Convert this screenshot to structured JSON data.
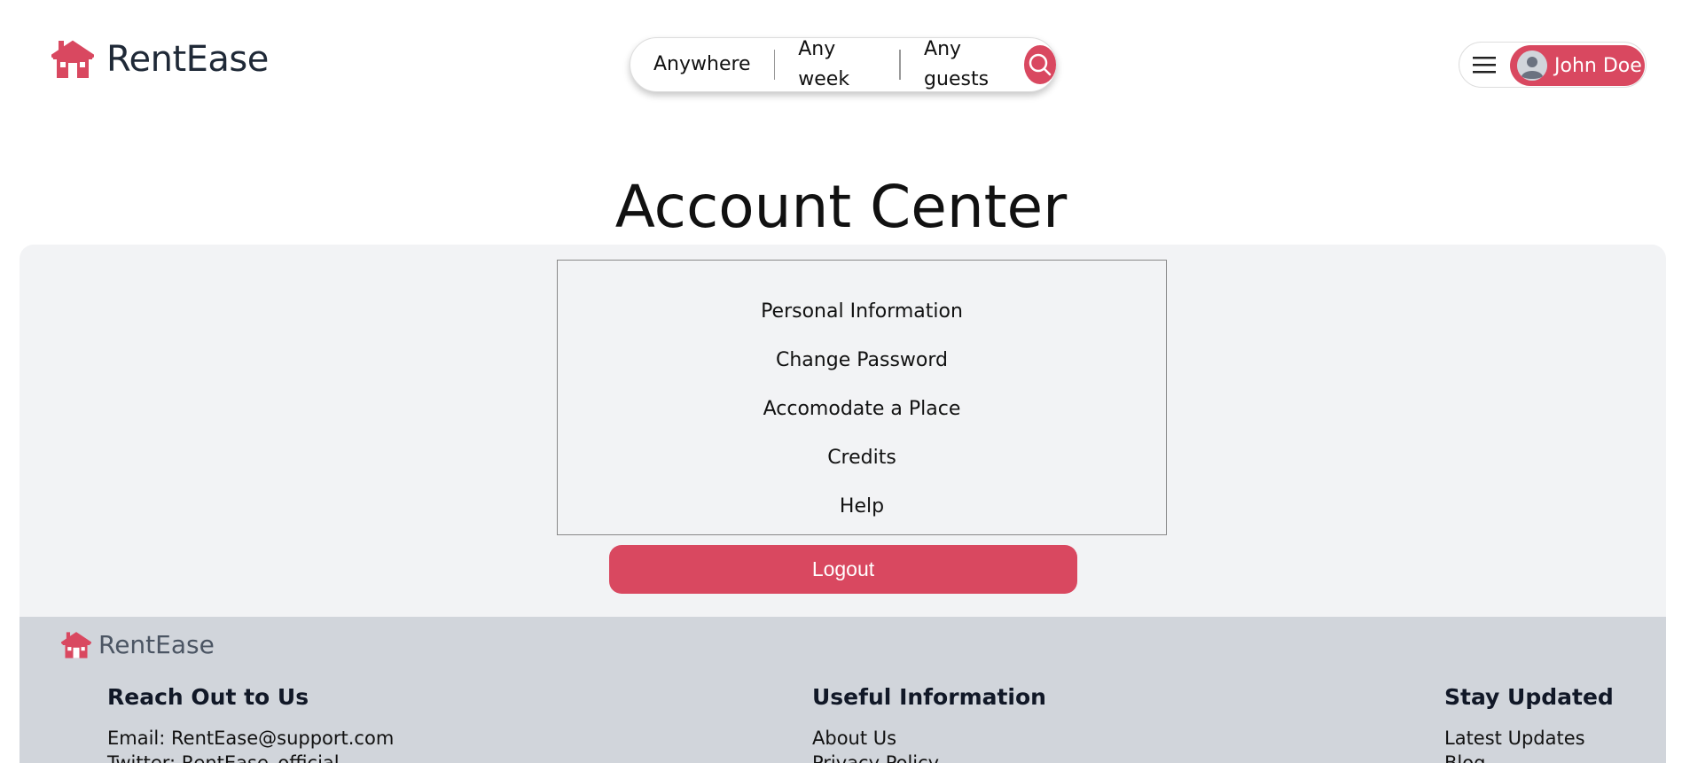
{
  "header": {
    "brand": "RentEase",
    "search": {
      "where": "Anywhere",
      "when": "Any week",
      "who": "Any guests"
    },
    "user": {
      "name": "John Doe"
    }
  },
  "main": {
    "title": "Account Center",
    "menu": [
      "Personal Information",
      "Change Password",
      "Accomodate a Place",
      "Credits",
      "Help"
    ],
    "logout_label": "Logout"
  },
  "footer": {
    "brand": "RentEase",
    "columns": [
      {
        "heading": "Reach Out to Us",
        "links": [
          "Email: RentEase@support.com",
          "Twitter: RentEase_official"
        ]
      },
      {
        "heading": "Useful Information",
        "links": [
          "About Us",
          "Privacy Policy"
        ]
      },
      {
        "heading": "Stay Updated",
        "links": [
          "Latest Updates",
          "Blog"
        ]
      }
    ]
  },
  "colors": {
    "accent": "#d94860",
    "panel": "#f2f3f5",
    "footer": "#d1d5db"
  },
  "icons": [
    "house-logo-icon",
    "search-icon",
    "hamburger-menu-icon",
    "user-avatar-icon"
  ]
}
